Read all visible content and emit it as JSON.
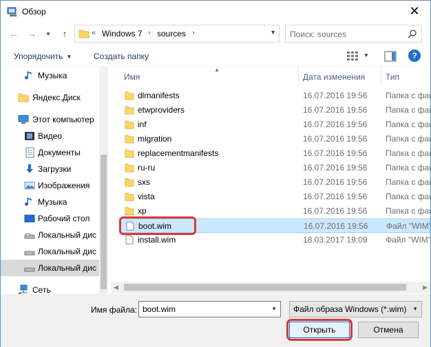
{
  "window": {
    "title": "Обзор"
  },
  "nav": {
    "path": [
      "Windows 7",
      "sources"
    ],
    "overflow": "«",
    "separator": "›",
    "search_placeholder": "Поиск: sources"
  },
  "toolbar": {
    "organize": "Упорядочить",
    "new_folder": "Создать папку"
  },
  "sidebar": {
    "items": [
      {
        "label": "Музыка",
        "icon": "music-icon"
      },
      {
        "label": "Яндекс.Диск",
        "icon": "folder-icon"
      },
      {
        "label": "Этот компьютер",
        "icon": "computer-icon"
      },
      {
        "label": "Видео",
        "icon": "video-icon"
      },
      {
        "label": "Документы",
        "icon": "documents-icon"
      },
      {
        "label": "Загрузки",
        "icon": "download-icon"
      },
      {
        "label": "Изображения",
        "icon": "pictures-icon"
      },
      {
        "label": "Музыка",
        "icon": "music-icon"
      },
      {
        "label": "Рабочий стол",
        "icon": "desktop-icon"
      },
      {
        "label": "Локальный дис",
        "icon": "drive-icon"
      },
      {
        "label": "Локальный дис",
        "icon": "drive-icon"
      },
      {
        "label": "Локальный дис",
        "icon": "drive-icon",
        "selected": true
      },
      {
        "label": "Сеть",
        "icon": "network-icon"
      }
    ]
  },
  "columns": {
    "name": "Имя",
    "date": "Дата изменения",
    "type": "Тип"
  },
  "files": [
    {
      "name": "dlmanifests",
      "date": "16.07.2016 19:56",
      "type": "Папка с фай",
      "kind": "folder"
    },
    {
      "name": "etwproviders",
      "date": "16.07.2016 19:56",
      "type": "Папка с фай",
      "kind": "folder"
    },
    {
      "name": "inf",
      "date": "16.07.2016 19:56",
      "type": "Папка с фай",
      "kind": "folder"
    },
    {
      "name": "migration",
      "date": "16.07.2016 19:56",
      "type": "Папка с фай",
      "kind": "folder"
    },
    {
      "name": "replacementmanifests",
      "date": "16.07.2016 19:56",
      "type": "Папка с фай",
      "kind": "folder"
    },
    {
      "name": "ru-ru",
      "date": "16.07.2016 19:56",
      "type": "Папка с фай",
      "kind": "folder"
    },
    {
      "name": "sxs",
      "date": "16.07.2016 19:56",
      "type": "Папка с фай",
      "kind": "folder"
    },
    {
      "name": "vista",
      "date": "16.07.2016 19:56",
      "type": "Папка с фай",
      "kind": "folder"
    },
    {
      "name": "xp",
      "date": "16.07.2016 19:56",
      "type": "Папка с фай",
      "kind": "folder"
    },
    {
      "name": "boot.wim",
      "date": "16.07.2016 19:56",
      "type": "Файл \"WIM\"",
      "kind": "file",
      "selected": true
    },
    {
      "name": "install.wim",
      "date": "18.03.2017 19:09",
      "type": "Файл \"WIM\"",
      "kind": "file"
    }
  ],
  "bottom": {
    "filename_label": "Имя файла:",
    "filename_value": "boot.wim",
    "filetype_value": "Файл образа Windows (*.wim)",
    "open_label": "Открыть",
    "cancel_label": "Отмена"
  },
  "colors": {
    "highlight": "#d9373b",
    "selection": "#cce8ff",
    "folder": "#ffd766"
  }
}
